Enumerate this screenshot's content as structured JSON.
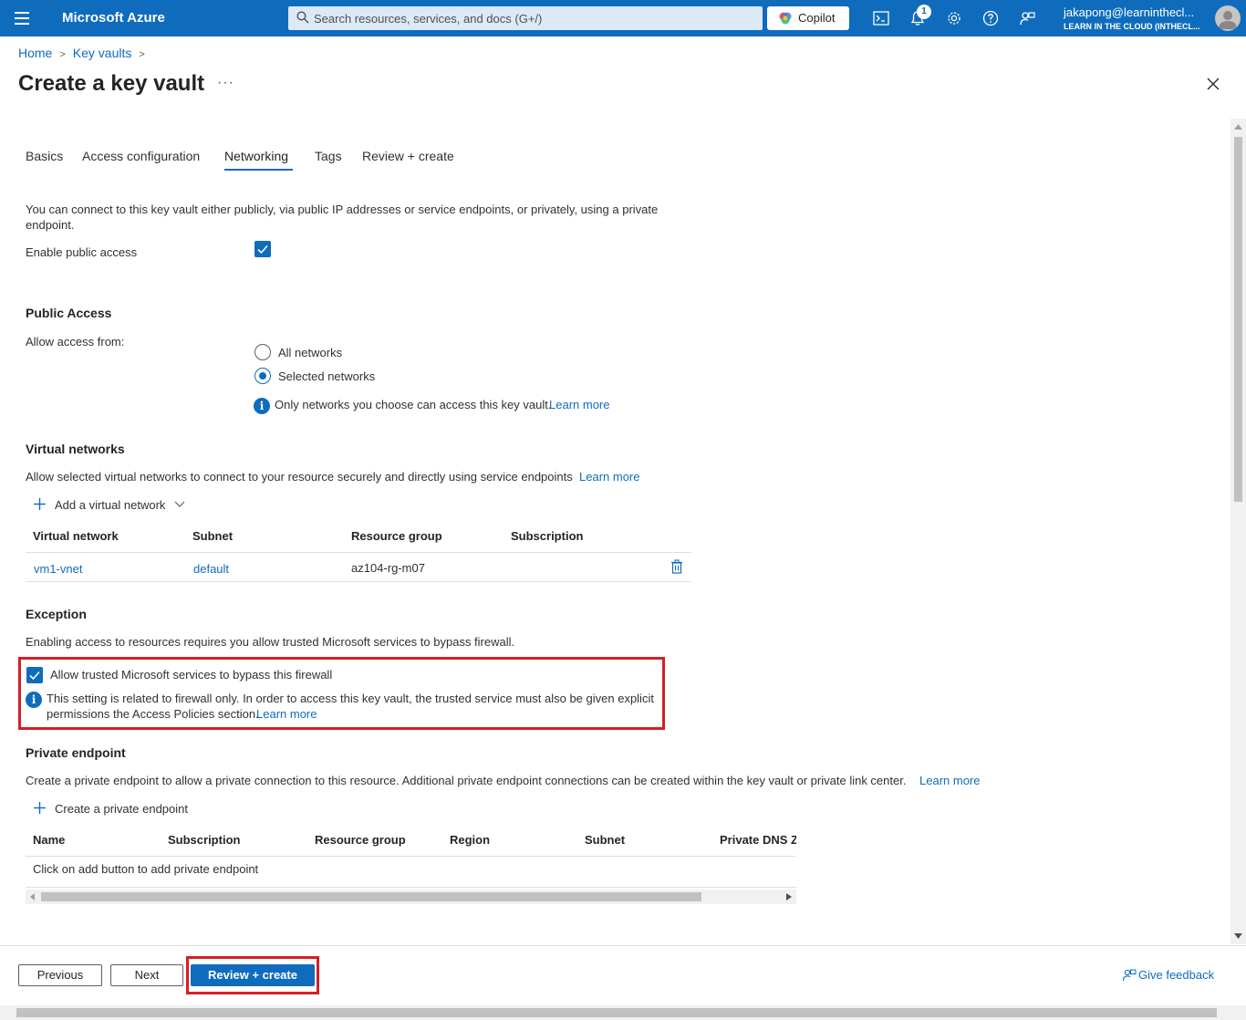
{
  "topbar": {
    "brand": "Microsoft Azure",
    "search_placeholder": "Search resources, services, and docs (G+/)",
    "copilot_label": "Copilot",
    "notification_count": "1",
    "account_name": "jakapong@learninthecl...",
    "account_org": "LEARN IN THE CLOUD (INTHECL..."
  },
  "breadcrumb": {
    "home": "Home",
    "key_vaults": "Key vaults"
  },
  "page": {
    "title": "Create a key vault",
    "more": "···"
  },
  "tabs": [
    {
      "label": "Basics"
    },
    {
      "label": "Access configuration"
    },
    {
      "label": "Networking"
    },
    {
      "label": "Tags"
    },
    {
      "label": "Review + create"
    }
  ],
  "networking": {
    "intro_line1": "You can connect to this key vault either publicly, via public IP addresses or service endpoints, or privately, using a private",
    "intro_line2": "endpoint.",
    "enable_public_access_label": "Enable public access",
    "enable_public_access_checked": true
  },
  "public_access": {
    "heading": "Public Access",
    "allow_from_label": "Allow access from:",
    "options": [
      {
        "label": "All networks",
        "selected": false
      },
      {
        "label": "Selected networks",
        "selected": true
      }
    ],
    "info_text": "Only networks you choose can access this key vault.",
    "learn_more": "Learn more"
  },
  "virtual_networks": {
    "heading": "Virtual networks",
    "description": "Allow selected virtual networks to connect to your resource securely and directly using service endpoints",
    "learn_more": "Learn more",
    "add_label": "Add a virtual network",
    "columns": [
      "Virtual network",
      "Subnet",
      "Resource group",
      "Subscription"
    ],
    "rows": [
      {
        "vnet": "vm1-vnet",
        "subnet": "default",
        "resource_group": "az104-rg-m07",
        "subscription": ""
      }
    ]
  },
  "exception": {
    "heading": "Exception",
    "description": "Enabling access to resources requires you allow trusted Microsoft services to bypass firewall.",
    "checkbox_label": "Allow trusted Microsoft services to bypass this firewall",
    "checkbox_checked": true,
    "info_line1": "This setting is related to firewall only. In order to access this key vault, the trusted service must also be given explicit",
    "info_line2": "permissions the Access Policies section.",
    "learn_more": "Learn more"
  },
  "private_endpoint": {
    "heading": "Private endpoint",
    "description": "Create a private endpoint to allow a private connection to this resource. Additional private endpoint connections can be created within the key vault or private link center.",
    "learn_more": "Learn more",
    "add_label": "Create a private endpoint",
    "columns": [
      "Name",
      "Subscription",
      "Resource group",
      "Region",
      "Subnet",
      "Private DNS Zo"
    ],
    "empty_text": "Click on add button to add private endpoint"
  },
  "footer": {
    "previous": "Previous",
    "next": "Next",
    "review_create": "Review + create",
    "feedback": "Give feedback"
  },
  "colors": {
    "azure_blue": "#0f6cbd",
    "highlight_red": "#d41f26"
  }
}
